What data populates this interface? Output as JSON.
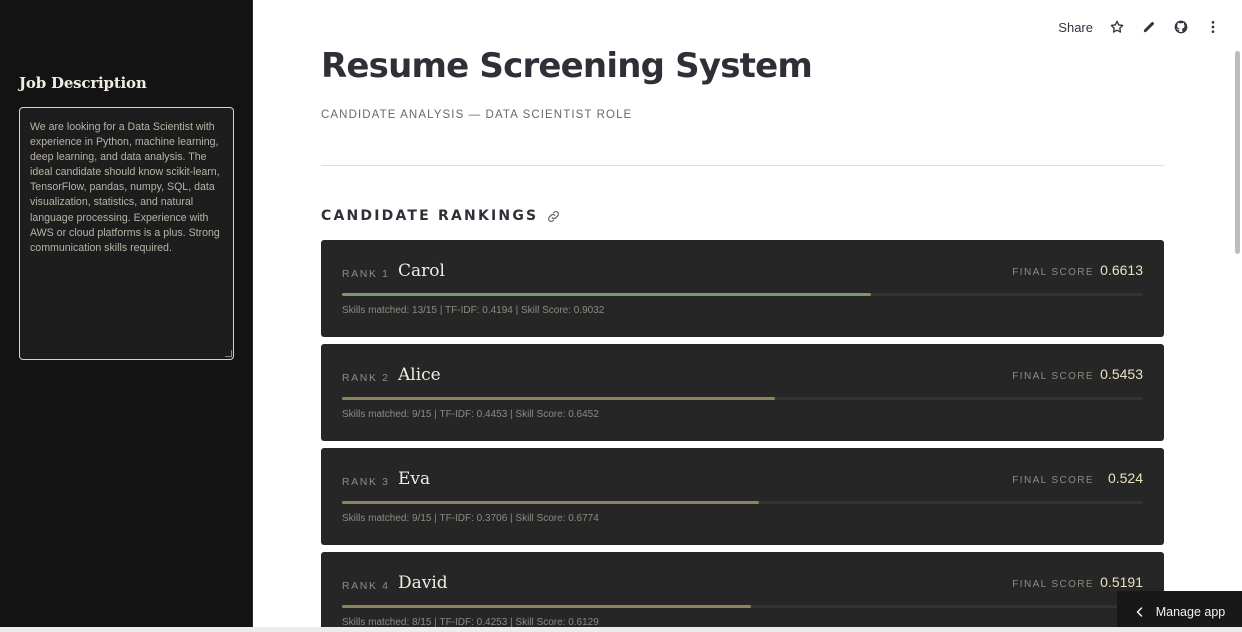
{
  "sidebar": {
    "title": "Job Description",
    "job_description": "We are looking for a Data Scientist with experience in Python, machine learning, deep learning, and data analysis. The ideal candidate should know scikit-learn, TensorFlow, pandas, numpy, SQL, data visualization, statistics, and natural language processing. Experience with AWS or cloud platforms is a plus. Strong communication skills required."
  },
  "toolbar": {
    "share_label": "Share",
    "icons": [
      "star-icon",
      "pencil-icon",
      "github-icon",
      "more-vert-icon"
    ]
  },
  "header": {
    "title": "Resume Screening System",
    "subtitle": "CANDIDATE ANALYSIS — DATA SCIENTIST ROLE"
  },
  "rankings": {
    "heading": "CANDIDATE RANKINGS",
    "score_label": "FINAL SCORE",
    "candidates": [
      {
        "rank": "RANK 1",
        "name": "Carol",
        "score": "0.6613",
        "score_fraction": 0.661,
        "bar_color": "#7a9a6c",
        "details": "Skills matched: 13/15  |  TF-IDF: 0.4194  |  Skill Score: 0.9032"
      },
      {
        "rank": "RANK 2",
        "name": "Alice",
        "score": "0.5453",
        "score_fraction": 0.541,
        "bar_color": "#8e8461",
        "details": "Skills matched: 9/15  |  TF-IDF: 0.4453  |  Skill Score: 0.6452"
      },
      {
        "rank": "RANK 3",
        "name": "Eva",
        "score": "0.524",
        "score_fraction": 0.521,
        "bar_color": "#8e8461",
        "details": "Skills matched: 9/15  |  TF-IDF: 0.3706  |  Skill Score: 0.6774"
      },
      {
        "rank": "RANK 4",
        "name": "David",
        "score": "0.5191",
        "score_fraction": 0.511,
        "bar_color": "#8e8461",
        "details": "Skills matched: 8/15  |  TF-IDF: 0.4253  |  Skill Score: 0.6129"
      }
    ]
  },
  "footer": {
    "manage_app_label": "Manage app"
  }
}
